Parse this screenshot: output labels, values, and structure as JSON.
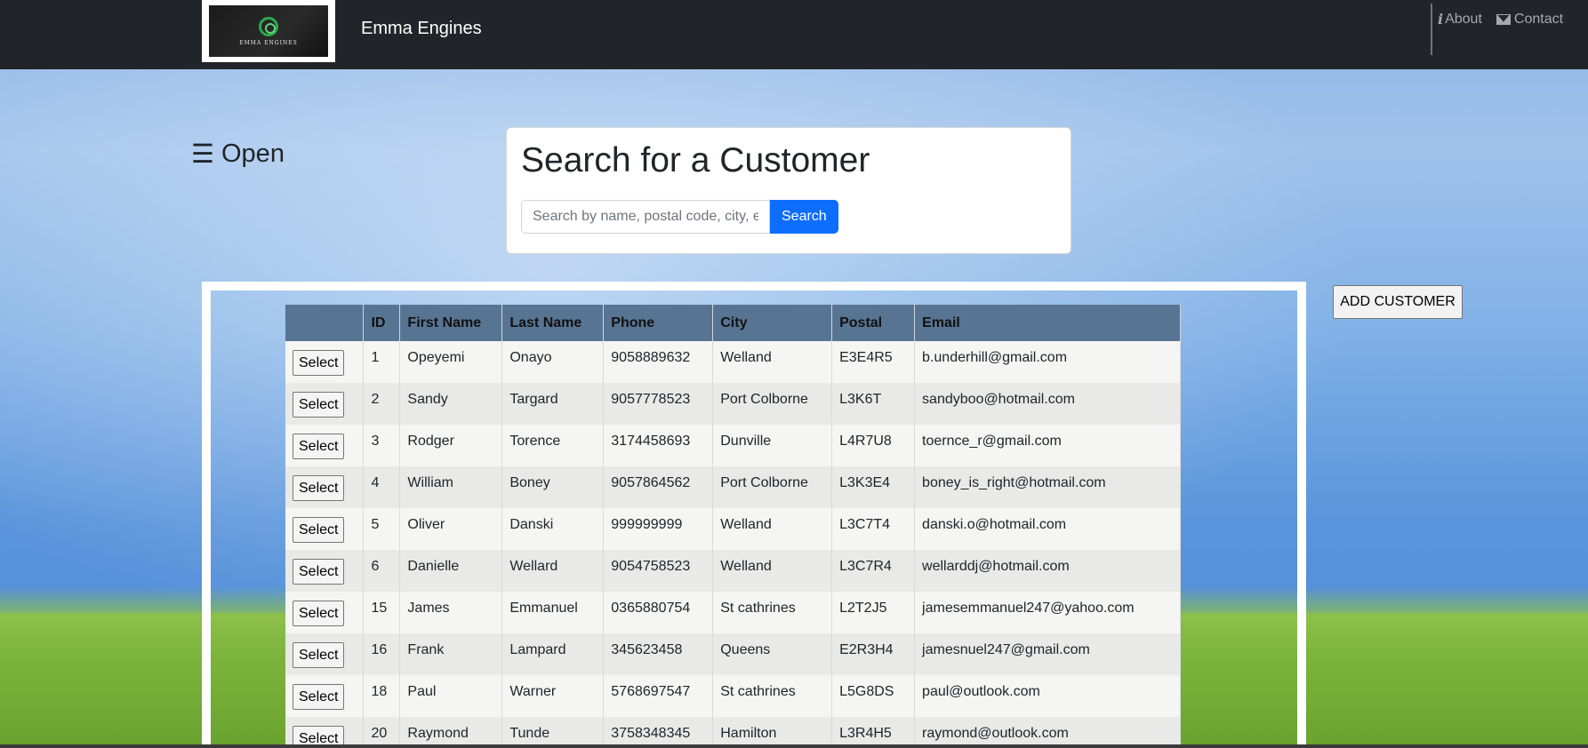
{
  "navbar": {
    "brand": "Emma Engines",
    "logo_text": "EMMA ENGINES",
    "about_label": "About",
    "contact_label": "Contact"
  },
  "sidebar_toggle": {
    "icon": "☰",
    "label": "Open"
  },
  "search": {
    "title": "Search for a Customer",
    "placeholder": "Search by name, postal code, city, e",
    "button_label": "Search"
  },
  "add_customer_label": "ADD CUSTOMER",
  "table": {
    "columns": [
      "",
      "ID",
      "First Name",
      "Last Name",
      "Phone",
      "City",
      "Postal",
      "Email"
    ],
    "select_label": "Select",
    "rows": [
      {
        "id": "1",
        "first": "Opeyemi",
        "last": "Onayo",
        "phone": "9058889632",
        "city": "Welland",
        "postal": "E3E4R5",
        "email": "b.underhill@gmail.com"
      },
      {
        "id": "2",
        "first": "Sandy",
        "last": "Targard",
        "phone": "9057778523",
        "city": "Port Colborne",
        "postal": "L3K6T",
        "email": "sandyboo@hotmail.com"
      },
      {
        "id": "3",
        "first": "Rodger",
        "last": "Torence",
        "phone": "3174458693",
        "city": "Dunville",
        "postal": "L4R7U8",
        "email": "toernce_r@gmail.com"
      },
      {
        "id": "4",
        "first": "William",
        "last": "Boney",
        "phone": "9057864562",
        "city": "Port Colborne",
        "postal": "L3K3E4",
        "email": "boney_is_right@hotmail.com"
      },
      {
        "id": "5",
        "first": "Oliver",
        "last": "Danski",
        "phone": "999999999",
        "city": "Welland",
        "postal": "L3C7T4",
        "email": "danski.o@hotmail.com"
      },
      {
        "id": "6",
        "first": "Danielle",
        "last": "Wellard",
        "phone": "9054758523",
        "city": "Welland",
        "postal": "L3C7R4",
        "email": "wellarddj@hotmail.com"
      },
      {
        "id": "15",
        "first": "James",
        "last": "Emmanuel",
        "phone": "0365880754",
        "city": "St cathrines",
        "postal": "L2T2J5",
        "email": "jamesemmanuel247@yahoo.com"
      },
      {
        "id": "16",
        "first": "Frank",
        "last": "Lampard",
        "phone": "345623458",
        "city": "Queens",
        "postal": "E2R3H4",
        "email": "jamesnuel247@gmail.com"
      },
      {
        "id": "18",
        "first": "Paul",
        "last": "Warner",
        "phone": "5768697547",
        "city": "St cathrines",
        "postal": "L5G8DS",
        "email": "paul@outlook.com"
      },
      {
        "id": "20",
        "first": "Raymond",
        "last": "Tunde",
        "phone": "3758348345",
        "city": "Hamilton",
        "postal": "L3R4H5",
        "email": "raymond@outlook.com"
      }
    ]
  }
}
